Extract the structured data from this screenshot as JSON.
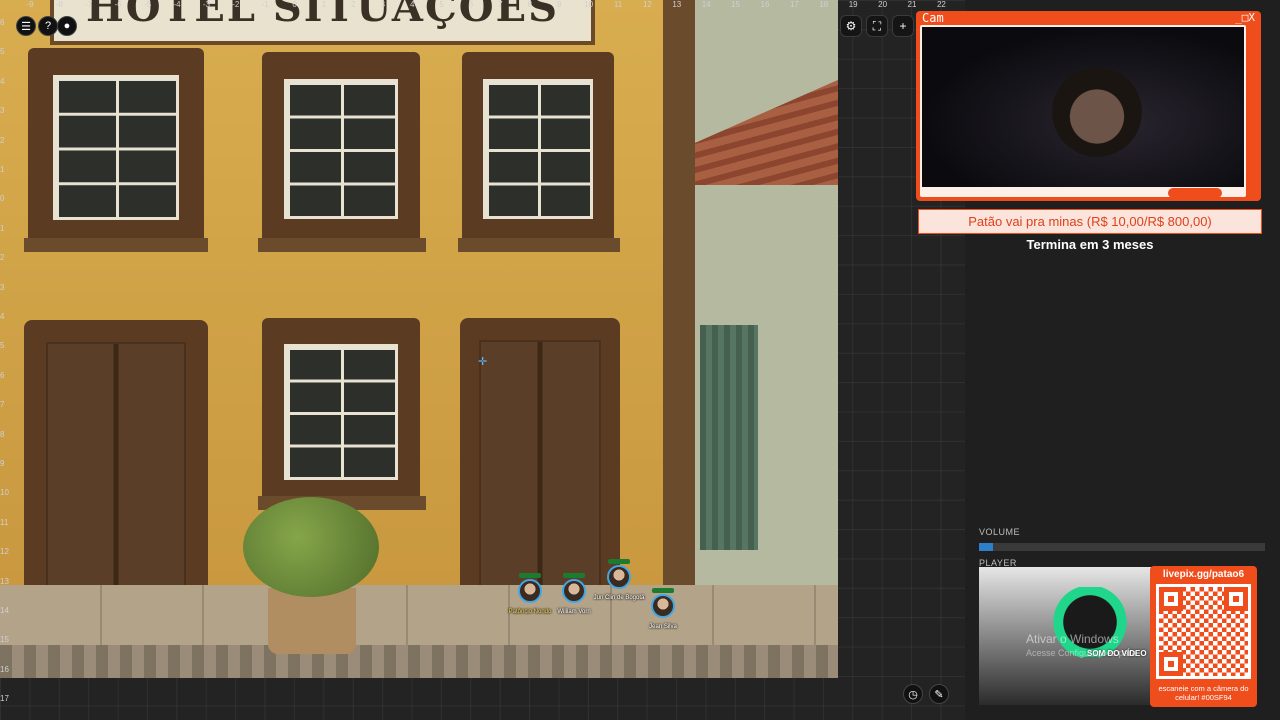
{
  "map": {
    "sign_text": "HOTEL SITUAÇÕES",
    "ruler_top": [
      "-9",
      "-8",
      "-7",
      "-6",
      "-5",
      "-4",
      "-3",
      "-2",
      "-1",
      "0",
      "1",
      "2",
      "3",
      "4",
      "5",
      "6",
      "7",
      "8",
      "9",
      "10",
      "11",
      "12",
      "13",
      "14",
      "15",
      "16",
      "17",
      "18",
      "19",
      "20",
      "21",
      "22"
    ],
    "ruler_left": [
      "6",
      "5",
      "4",
      "3",
      "2",
      "1",
      "0",
      "1",
      "2",
      "3",
      "4",
      "5",
      "6",
      "7",
      "8",
      "9",
      "10",
      "11",
      "12",
      "13",
      "14",
      "15",
      "16",
      "17"
    ],
    "tokens": [
      {
        "name": "Patôncio Nondo",
        "highlight": true
      },
      {
        "name": "William Vorn",
        "highlight": false
      },
      {
        "name": "Jun Clin de Bogotá",
        "highlight": false
      },
      {
        "name": "Jean Silva",
        "highlight": false
      }
    ]
  },
  "toolbar": {
    "menu_icon": "hamburger-icon",
    "help_label": "?",
    "record_icon": "dot-icon",
    "settings_icon": "gear-icon",
    "fullscreen_icon": "expand-icon",
    "add_label": "+",
    "clock_icon": "clock-icon",
    "ruler_icon": "ruler-icon"
  },
  "cam": {
    "title": "Cam",
    "controls": "_□X"
  },
  "goal": {
    "text": "Patão vai pra minas (R$ 10,00/R$ 800,00)",
    "progress": 0.0125,
    "subtitle": "Termina em 3 meses"
  },
  "audio": {
    "volume_label": "VOLUME",
    "volume_value": 0.05,
    "player_label": "PLAYER",
    "player_caption": "SOM DO VÍDEO"
  },
  "windows_watermark": {
    "line1": "Ativar o Windows",
    "line2": "Acesse Configurações para"
  },
  "livepix": {
    "title": "livepix.gg/patao6",
    "caption": "escaneie com a câmera do celular! #00SF94"
  },
  "colors": {
    "accent": "#f04d1c",
    "volume_fill": "#2d7fc8",
    "panel_bg": "#1f1f1f"
  }
}
